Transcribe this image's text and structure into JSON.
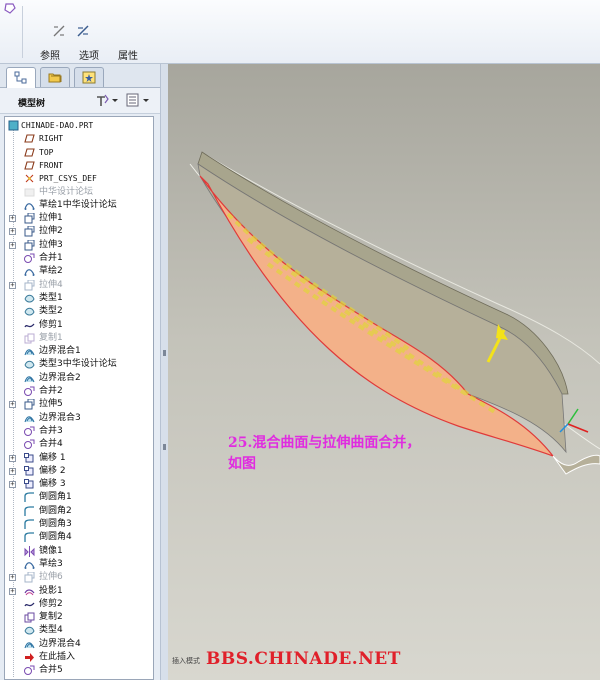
{
  "ribbon": {
    "groups": [
      {
        "label": "参照",
        "icon": "reference-icon"
      },
      {
        "label": "选项",
        "icon": "options-icon"
      },
      {
        "label": "属性",
        "icon": "properties-icon"
      }
    ]
  },
  "panel": {
    "title": "模型树",
    "tabs": [
      "model-tree-tab",
      "folder-browser-tab",
      "favorites-tab"
    ]
  },
  "tree": [
    {
      "label": "CHINADE-DAO.PRT",
      "icon": "part-icon",
      "kind": "root"
    },
    {
      "label": "RIGHT",
      "icon": "datum-plane-icon",
      "kind": "datum"
    },
    {
      "label": "TOP",
      "icon": "datum-plane-icon",
      "kind": "datum"
    },
    {
      "label": "FRONT",
      "icon": "datum-plane-icon",
      "kind": "datum"
    },
    {
      "label": "PRT_CSYS_DEF",
      "icon": "csys-icon",
      "kind": "datum"
    },
    {
      "label": "中华设计论坛",
      "icon": "dim-feature-icon",
      "kind": "dim"
    },
    {
      "label": "草绘1中华设计论坛",
      "icon": "sketch-icon"
    },
    {
      "label": "拉伸1",
      "icon": "extrude-icon",
      "expand": true
    },
    {
      "label": "拉伸2",
      "icon": "extrude-icon",
      "expand": true
    },
    {
      "label": "拉伸3",
      "icon": "extrude-icon",
      "expand": true
    },
    {
      "label": "合并1",
      "icon": "merge-icon"
    },
    {
      "label": "草绘2",
      "icon": "sketch-icon"
    },
    {
      "label": "拉伸4",
      "icon": "extrude-icon",
      "expand": true,
      "kind": "dim"
    },
    {
      "label": "类型1",
      "icon": "style-icon"
    },
    {
      "label": "类型2",
      "icon": "style-icon"
    },
    {
      "label": "修剪1",
      "icon": "trim-icon"
    },
    {
      "label": "复制1",
      "icon": "copy-icon",
      "kind": "dim"
    },
    {
      "label": "边界混合1",
      "icon": "boundary-blend-icon"
    },
    {
      "label": "类型3中华设计论坛",
      "icon": "style-icon"
    },
    {
      "label": "边界混合2",
      "icon": "boundary-blend-icon"
    },
    {
      "label": "合并2",
      "icon": "merge-icon"
    },
    {
      "label": "拉伸5",
      "icon": "extrude-icon",
      "expand": true
    },
    {
      "label": "边界混合3",
      "icon": "boundary-blend-icon"
    },
    {
      "label": "合并3",
      "icon": "merge-icon"
    },
    {
      "label": "合并4",
      "icon": "merge-icon"
    },
    {
      "label": "偏移 1",
      "icon": "offset-icon",
      "expand": true
    },
    {
      "label": "偏移 2",
      "icon": "offset-icon",
      "expand": true
    },
    {
      "label": "偏移 3",
      "icon": "offset-icon",
      "expand": true
    },
    {
      "label": "倒圆角1",
      "icon": "round-icon"
    },
    {
      "label": "倒圆角2",
      "icon": "round-icon"
    },
    {
      "label": "倒圆角3",
      "icon": "round-icon"
    },
    {
      "label": "倒圆角4",
      "icon": "round-icon"
    },
    {
      "label": "镜像1",
      "icon": "mirror-icon"
    },
    {
      "label": "草绘3",
      "icon": "sketch-icon"
    },
    {
      "label": "拉伸6",
      "icon": "extrude-icon",
      "expand": true,
      "kind": "dim"
    },
    {
      "label": "投影1",
      "icon": "project-icon",
      "expand": true
    },
    {
      "label": "修剪2",
      "icon": "trim-icon"
    },
    {
      "label": "复制2",
      "icon": "copy-icon"
    },
    {
      "label": "类型4",
      "icon": "style-icon"
    },
    {
      "label": "边界混合4",
      "icon": "boundary-blend-icon"
    },
    {
      "label": "在此插入",
      "icon": "insert-here-icon",
      "kind": "insert"
    },
    {
      "label": "合并5",
      "icon": "merge-icon"
    }
  ],
  "viewport": {
    "caption": "25.混合曲面与拉伸曲面合并，\n如图",
    "watermark": "BBS.CHINADE.NET",
    "status": "插入模式"
  },
  "colors": {
    "caption": "#e02ce0",
    "watermark": "#e0202a",
    "surface": "#f3b189",
    "highlight": "#e0d43a",
    "edge": "#e03a3a"
  }
}
